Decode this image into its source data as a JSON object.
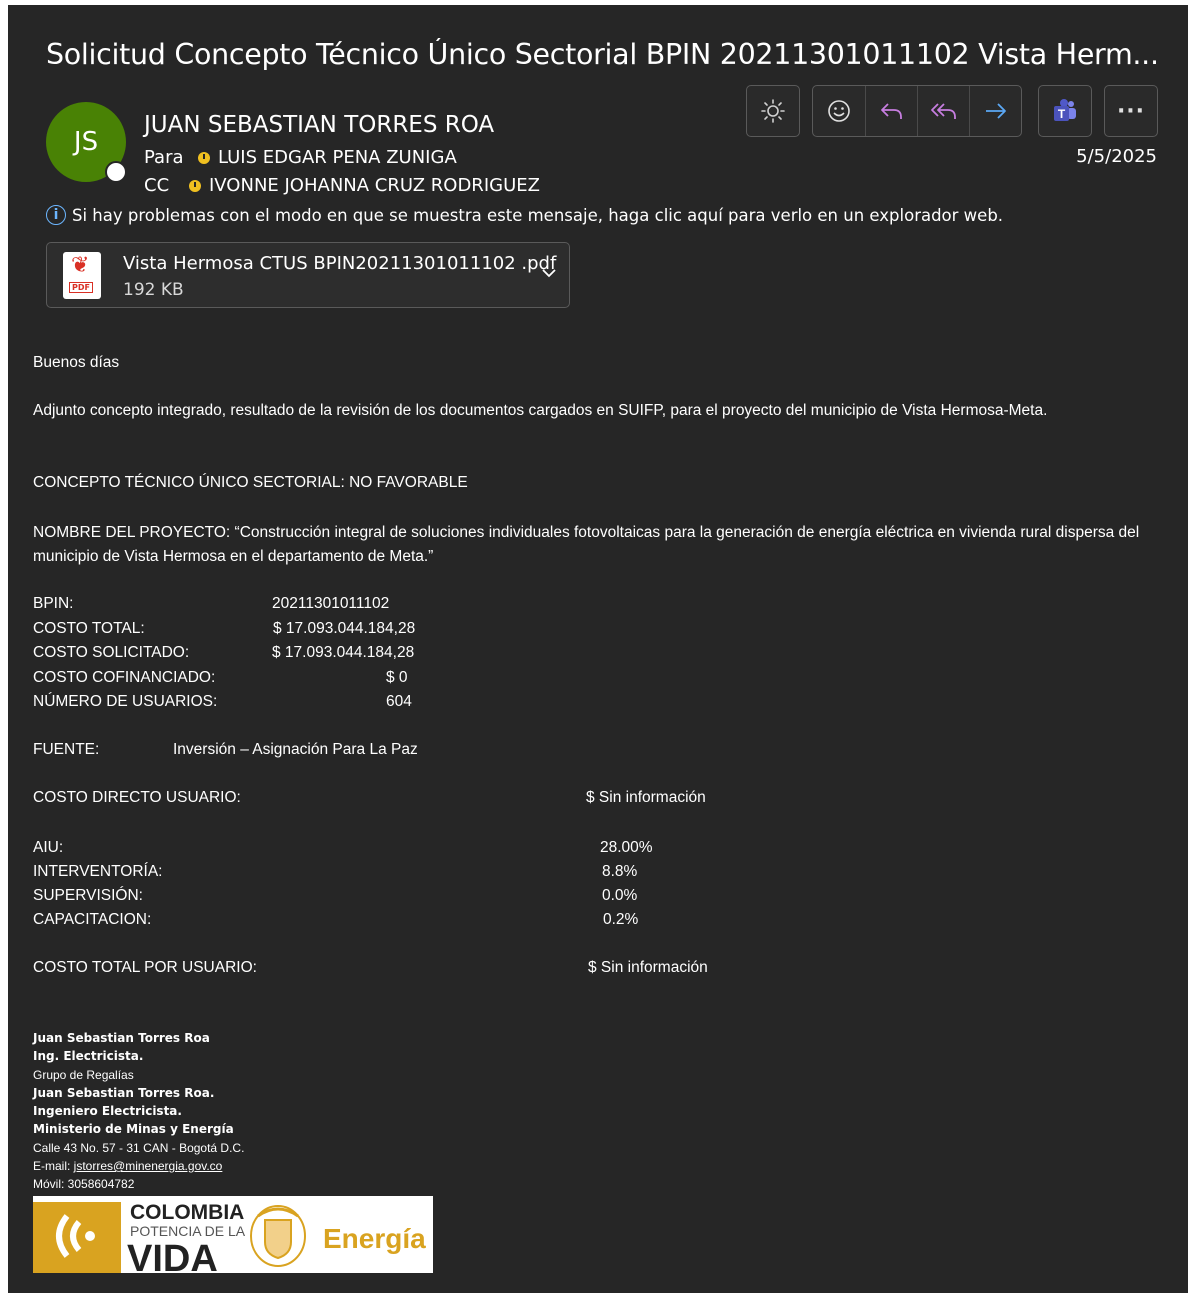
{
  "email": {
    "subject": "Solicitud Concepto Técnico Único Sectorial BPIN 20211301011102 Vista Herm...",
    "sender": {
      "initials": "JS",
      "name": "JUAN SEBASTIAN TORRES ROA"
    },
    "to_label": "Para",
    "to": "LUIS EDGAR PENA ZUNIGA",
    "cc_label": "CC",
    "cc": "IVONNE JOHANNA CRUZ RODRIGUEZ",
    "date": "5/5/2025",
    "info_message": "Si hay problemas con el modo en que se muestra este mensaje, haga clic aquí para verlo en un explorador web.",
    "attachment": {
      "name": "Vista Hermosa CTUS BPIN20211301011102 .pdf",
      "size": "192 KB",
      "type_label": "PDF"
    }
  },
  "toolbar": {
    "icons": [
      "brightness-icon",
      "emoji-icon",
      "reply-icon",
      "reply-all-icon",
      "forward-icon",
      "teams-icon",
      "more-icon"
    ],
    "more": "···"
  },
  "body": {
    "greeting": "Buenos días",
    "intro": "Adjunto concepto integrado, resultado de la revisión de los documentos cargados en SUIFP, para el proyecto del municipio de Vista Hermosa-Meta.",
    "concept": "CONCEPTO TÉCNICO ÚNICO SECTORIAL: NO FAVORABLE",
    "project_name": "NOMBRE DEL PROYECTO: “Construcción integral de soluciones individuales fotovoltaicas para la generación de energía eléctrica en vivienda rural dispersa del municipio de Vista Hermosa en el departamento de Meta.”",
    "fields": [
      {
        "label": "BPIN:",
        "value": "20211301011102"
      },
      {
        "label": "COSTO TOTAL:",
        "value": "$ 17.093.044.184,28"
      },
      {
        "label": "COSTO SOLICITADO:",
        "value": "$  17.093.044.184,28"
      },
      {
        "label": "COSTO COFINANCIADO:",
        "value": "$ 0"
      },
      {
        "label": "NÚMERO DE USUARIOS:",
        "value": "604"
      }
    ],
    "fuente_label": "FUENTE:",
    "fuente_value": "Inversión – Asignación Para La Paz",
    "costo_directo_label": "COSTO DIRECTO USUARIO:",
    "costo_directo_value": "$ Sin información",
    "percentages": [
      {
        "label": "AIU:",
        "value": "28.00%"
      },
      {
        "label": "INTERVENTORÍA:",
        "value": "8.8%"
      },
      {
        "label": "SUPERVISIÓN:",
        "value": "0.0%"
      },
      {
        "label": "CAPACITACION:",
        "value": "0.2%"
      }
    ],
    "costo_total_usuario_label": "COSTO TOTAL POR USUARIO:",
    "costo_total_usuario_value": "$ Sin información"
  },
  "signature": {
    "line1": "Juan Sebastian Torres Roa",
    "line2": "Ing. Electricista.",
    "line3": "Grupo de Regalías",
    "line4": "Juan Sebastian Torres Roa.",
    "line5": "Ingeniero Electricista.",
    "line6": "Ministerio de Minas y Energía",
    "line7": "Calle 43 No. 57 - 31 CAN - Bogotá D.C.",
    "email_label": "E-mail: ",
    "email": "jstorres@minenergia.gov.co",
    "mobile": "Móvil: 3058604782",
    "logo": {
      "line1": "COLOMBIA",
      "line2": "POTENCIA DE LA",
      "line3": "VIDA",
      "brand": "Energía"
    }
  },
  "colors": {
    "background": "#262626",
    "avatar": "#498205",
    "link": "#6cb6ff",
    "logo_gold": "#d9a320"
  }
}
